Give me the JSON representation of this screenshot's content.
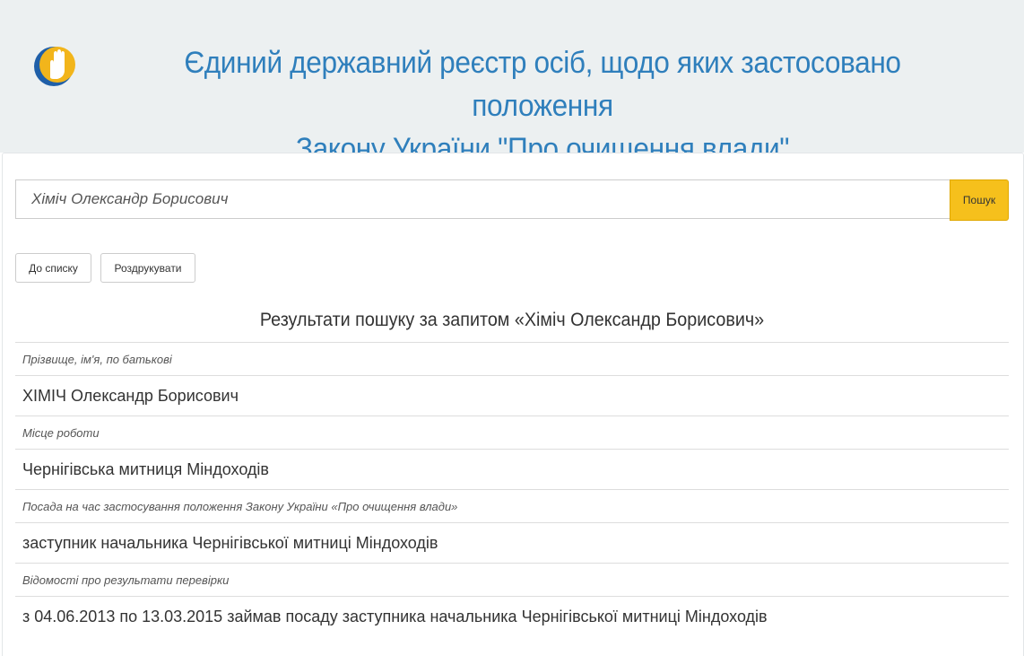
{
  "header": {
    "title_line1": "Єдиний державний реєстр осіб, щодо яких застосовано положення",
    "title_line2": "Закону України \"Про очищення влади\""
  },
  "search": {
    "value": "Хіміч Олександр Борисович",
    "button_label": "Пошук"
  },
  "actions": {
    "back_label": "До списку",
    "print_label": "Роздрукувати"
  },
  "results": {
    "title": "Результати пошуку за запитом «Хіміч Олександр Борисович»",
    "rows": [
      {
        "label": "Прізвище, ім'я, по батькові",
        "value": "ХІМІЧ Олександр Борисович"
      },
      {
        "label": "Місце роботи",
        "value": "Чернігівська митниця Міндоходів"
      },
      {
        "label": "Посада на час застосування положення Закону України «Про очищення влади»",
        "value": "заступник начальника Чернігівської митниці Міндоходів"
      },
      {
        "label": "Відомості про результати перевірки",
        "value": "з 04.06.2013 по 13.03.2015 займав посаду заступника начальника Чернігівської митниці Міндоходів"
      }
    ]
  },
  "colors": {
    "header_bg": "#ecf0f1",
    "title": "#2f7fbc",
    "search_button": "#f6c01c"
  },
  "icons": {
    "logo": "raised-hand-logo-icon"
  }
}
